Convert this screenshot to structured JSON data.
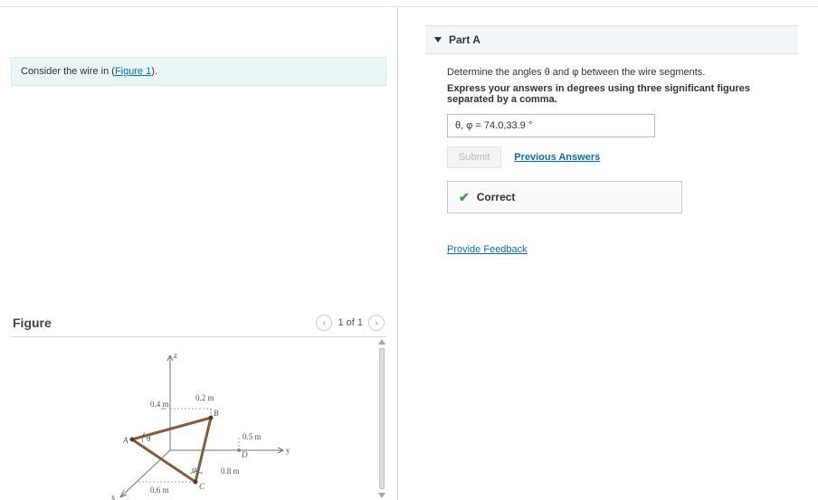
{
  "left": {
    "instruction_prefix": "Consider the wire in (",
    "instruction_link": "Figure 1",
    "instruction_suffix": ").",
    "figure_title": "Figure",
    "nav_text": "1 of 1",
    "figure": {
      "dim_04": "0.4 m",
      "dim_02": "0.2 m",
      "dim_05": "0.5 m",
      "dim_08": "0.8 m",
      "dim_06": "0.6 m",
      "pt_A": "A",
      "pt_B": "B",
      "pt_C": "C",
      "pt_D": "D",
      "axis_x": "x",
      "axis_y": "y",
      "axis_z": "z",
      "theta": "θ",
      "phi": "φ"
    }
  },
  "right": {
    "part_title": "Part A",
    "prompt": "Determine the angles θ and φ between the wire segments.",
    "instruction": "Express your answers in degrees using three significant figures separated by a comma.",
    "answer_label": "θ, φ = ",
    "answer_value": "74.0,33.9",
    "answer_unit": " °",
    "submit_label": "Submit",
    "prev_answers": "Previous Answers",
    "correct_label": "Correct",
    "feedback": "Provide Feedback"
  }
}
